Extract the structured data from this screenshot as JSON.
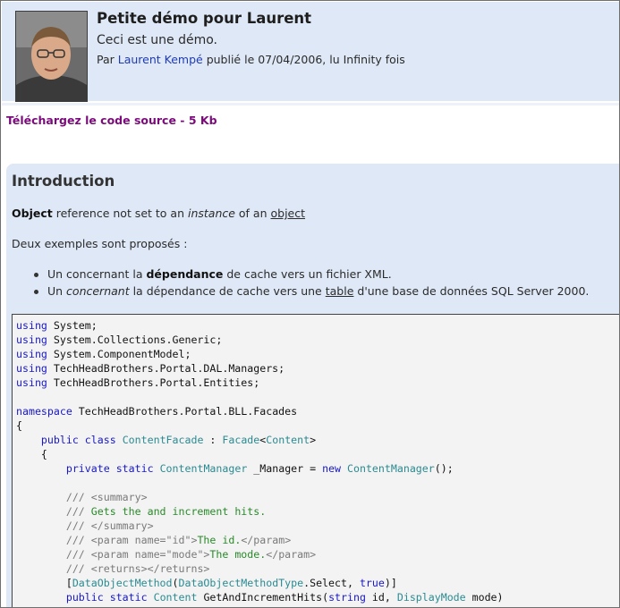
{
  "header": {
    "title": "Petite démo pour Laurent",
    "subtitle": "Ceci est une démo.",
    "meta_prefix": "Par ",
    "author": "Laurent Kempé",
    "meta_suffix": " publié le 07/04/2006, lu Infinity fois"
  },
  "download": {
    "label": "Téléchargez le code source - 5 Kb"
  },
  "article": {
    "heading": "Introduction",
    "para1": {
      "bold": "Object",
      "t1": " reference not set to an ",
      "italic": "instance",
      "t2": " of an ",
      "link": "object"
    },
    "para2": "Deux exemples sont proposés :",
    "bullets": [
      {
        "t1": "Un concernant la ",
        "bold": "dépendance",
        "t2": " de cache vers un fichier XML."
      },
      {
        "t1": "Un ",
        "italic": "concernant",
        "t2": " la dépendance de cache vers une ",
        "link": "table",
        "t3": " d'une base de données SQL Server 2000."
      }
    ]
  },
  "code": {
    "lines": [
      "using System;",
      "using System.Collections.Generic;",
      "using System.ComponentModel;",
      "using TechHeadBrothers.Portal.DAL.Managers;",
      "using TechHeadBrothers.Portal.Entities;",
      "",
      "namespace TechHeadBrothers.Portal.BLL.Facades",
      "{",
      "    public class ContentFacade : Facade<Content>",
      "    {",
      "        private static ContentManager _Manager = new ContentManager();",
      "",
      "        /// <summary>",
      "        /// Gets the and increment hits.",
      "        /// </summary>",
      "        /// <param name=\"id\">The id.</param>",
      "        /// <param name=\"mode\">The mode.</param>",
      "        /// <returns></returns>",
      "        [DataObjectMethod(DataObjectMethodType.Select, true)]",
      "        public static Content GetAndIncrementHits(string id, DisplayMode mode)"
    ]
  }
}
